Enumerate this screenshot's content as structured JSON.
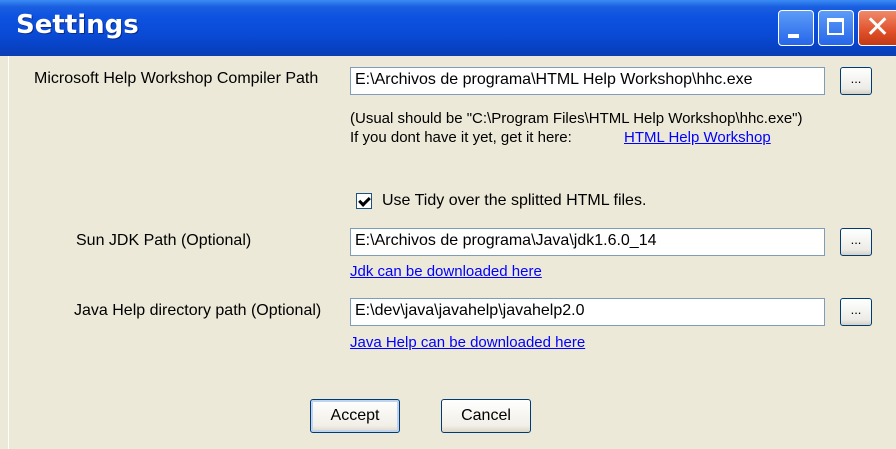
{
  "window": {
    "title": "Settings"
  },
  "compiler": {
    "label": "Microsoft Help Workshop Compiler Path",
    "value": "E:\\Archivos de programa\\HTML Help Workshop\\hhc.exe",
    "browse_label": "...",
    "hint": "(Usual should be \"C:\\Program Files\\HTML Help Workshop\\hhc.exe\")",
    "get_it_text": "If you dont have it yet, get it here:",
    "link_text": "HTML Help Workshop"
  },
  "tidy": {
    "label": "Use Tidy over the splitted HTML files.",
    "checked": true
  },
  "jdk": {
    "label": "Sun JDK Path (Optional)",
    "value": "E:\\Archivos de programa\\Java\\jdk1.6.0_14",
    "browse_label": "...",
    "link_text": "Jdk can be downloaded here"
  },
  "javahelp": {
    "label": "Java Help directory path (Optional)",
    "value": "E:\\dev\\java\\javahelp\\javahelp2.0",
    "browse_label": "...",
    "link_text": "Java Help can be downloaded here"
  },
  "buttons": {
    "accept": "Accept",
    "cancel": "Cancel"
  }
}
